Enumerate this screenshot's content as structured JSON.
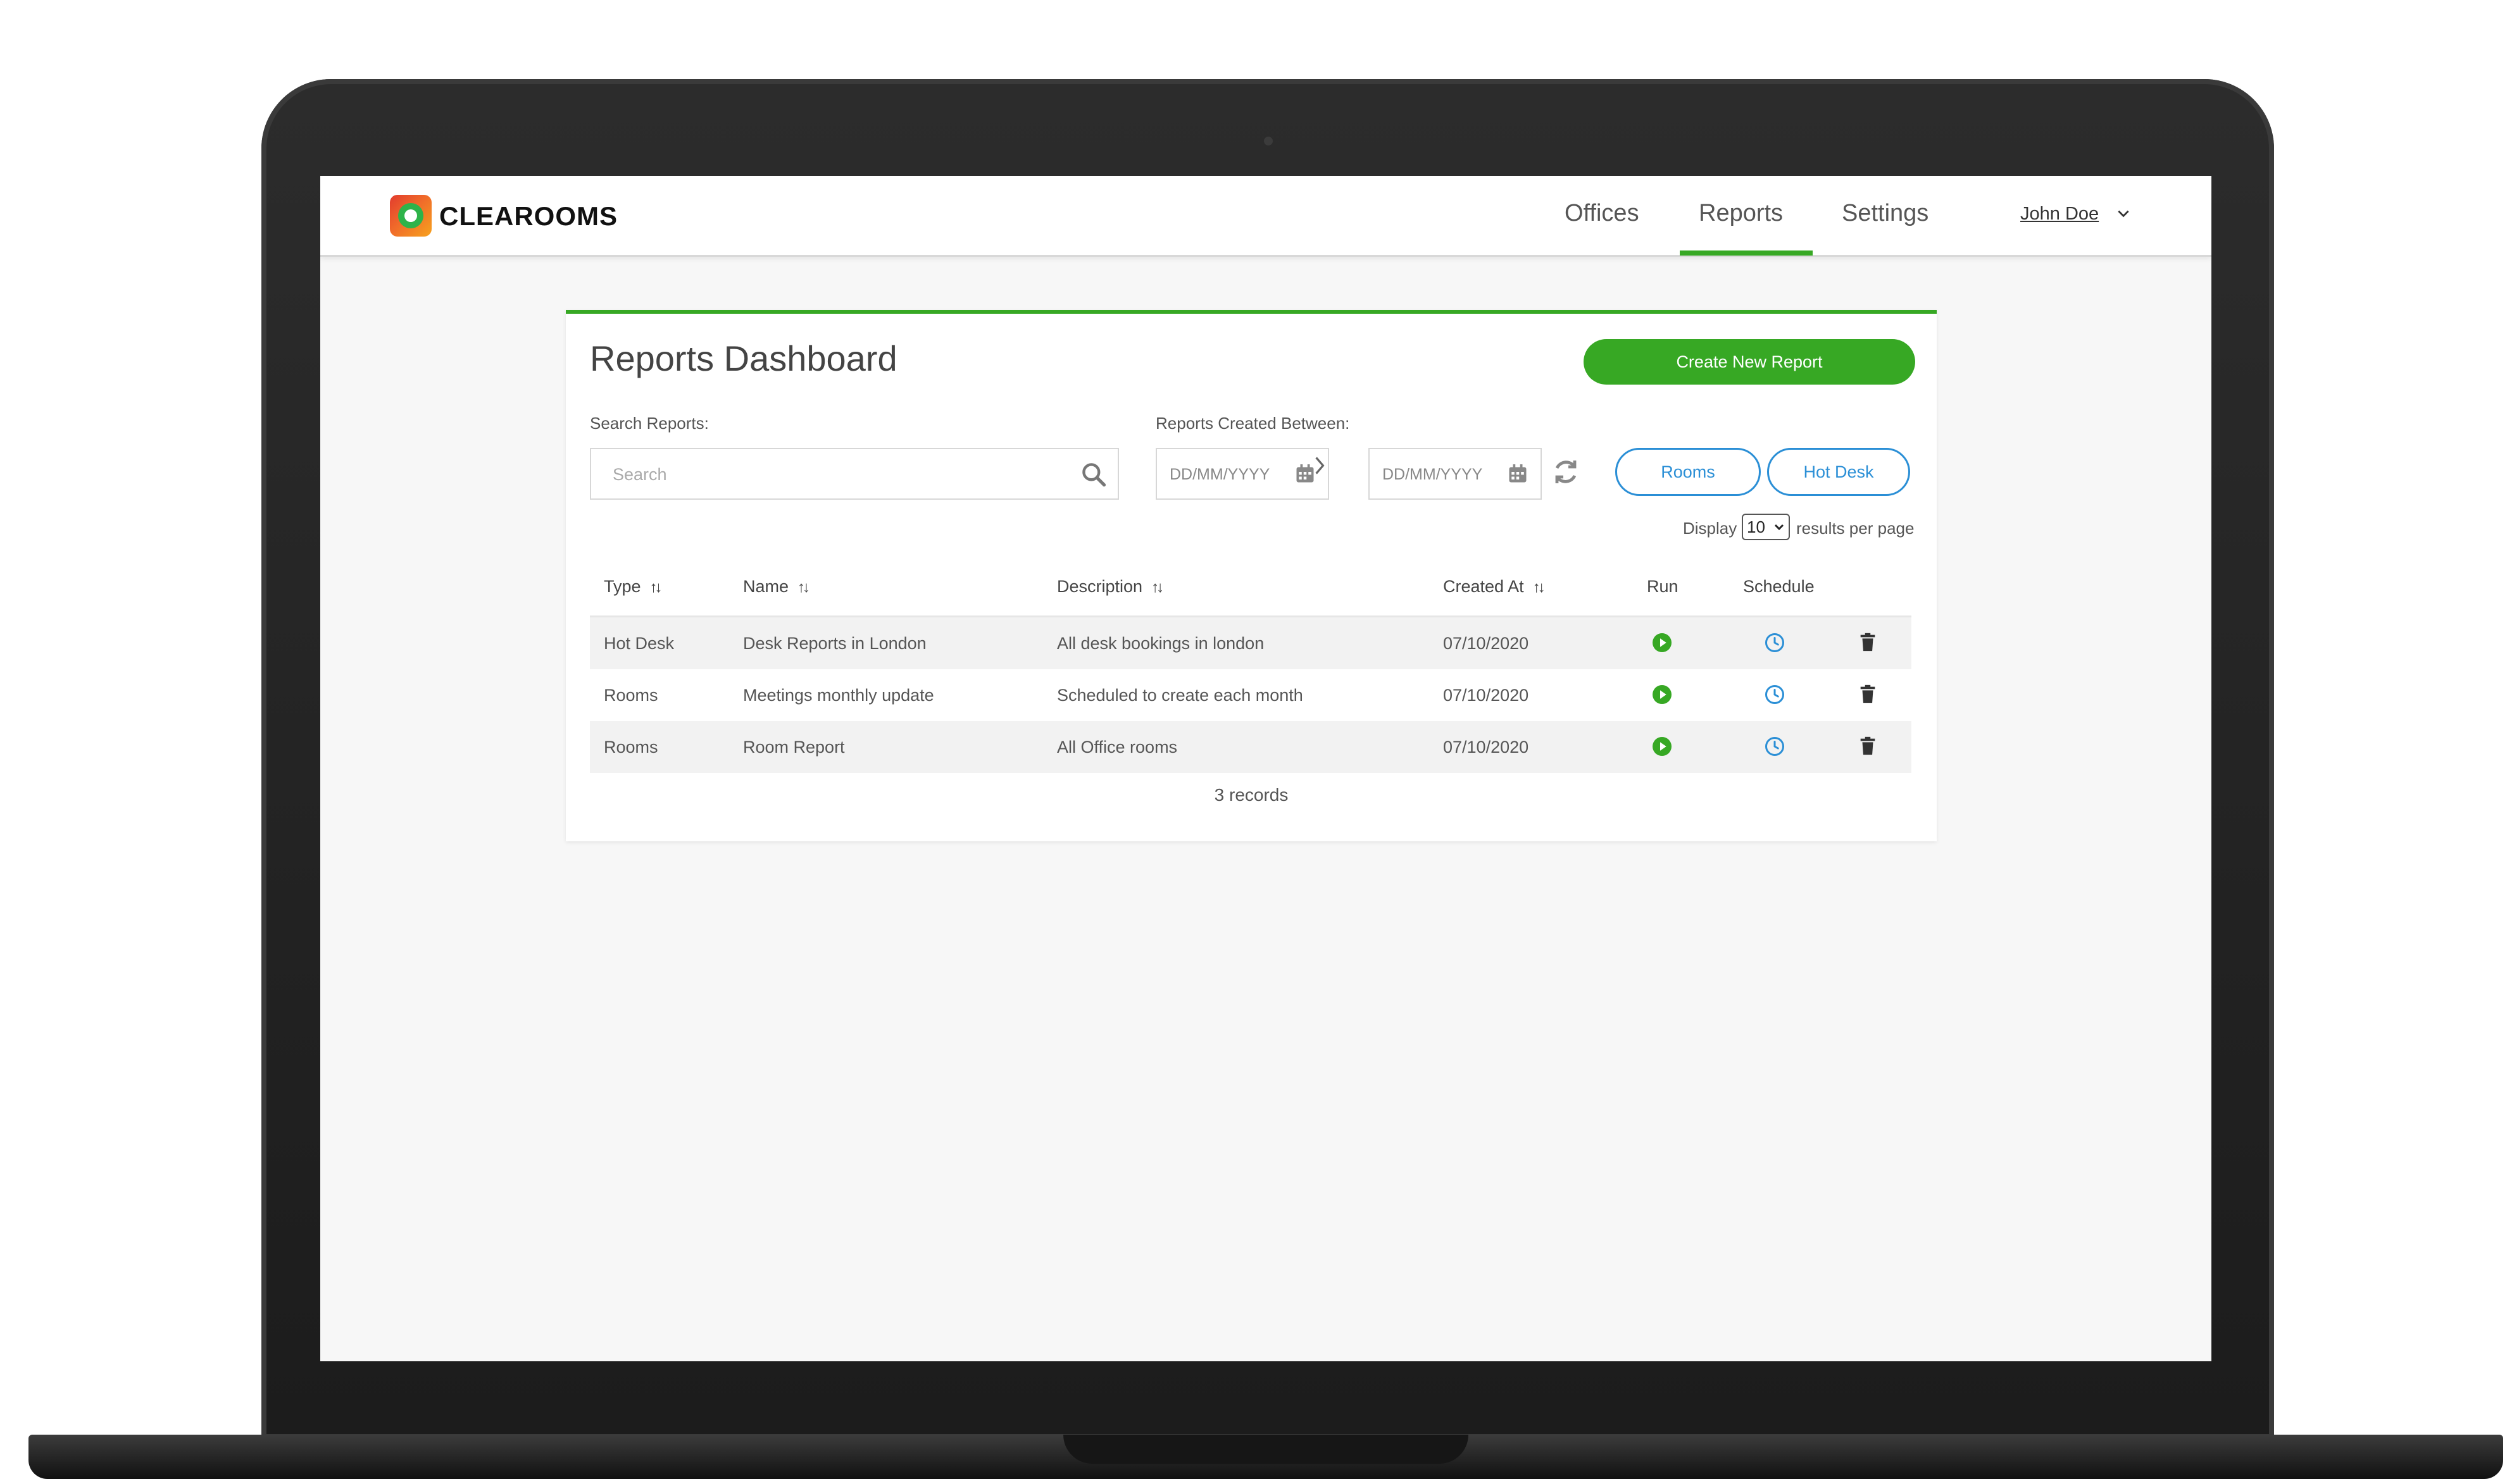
{
  "app": {
    "brand": "CLEAROOMS",
    "colors": {
      "accent": "#37a824",
      "link_blue": "#2b8fd6",
      "text": "#555555"
    }
  },
  "nav": {
    "tabs": [
      {
        "label": "Offices",
        "active": false
      },
      {
        "label": "Reports",
        "active": true
      },
      {
        "label": "Settings",
        "active": false
      }
    ],
    "user": "John Doe"
  },
  "dashboard": {
    "title": "Reports Dashboard",
    "create_button": "Create New Report",
    "search_label": "Search Reports:",
    "search_placeholder": "Search",
    "date_label": "Reports Created Between:",
    "date_from_placeholder": "DD/MM/YYYY",
    "date_to_placeholder": "DD/MM/YYYY",
    "filters": [
      "Rooms",
      "Hot Desk"
    ],
    "display_label": "Display",
    "per_page_value": "10",
    "per_page_suffix": "results per page"
  },
  "table": {
    "headers": [
      "Type",
      "Name",
      "Description",
      "Created At",
      "Run",
      "Schedule"
    ],
    "rows": [
      {
        "type": "Hot Desk",
        "name": "Desk Reports in London",
        "description": "All desk bookings in london",
        "created_at": "07/10/2020"
      },
      {
        "type": "Rooms",
        "name": "Meetings monthly update",
        "description": "Scheduled to create each month",
        "created_at": "07/10/2020"
      },
      {
        "type": "Rooms",
        "name": "Room Report",
        "description": "All Office rooms",
        "created_at": "07/10/2020"
      }
    ],
    "records_text": "3 records",
    "icons": {
      "run": "play-circle-icon",
      "schedule": "clock-icon",
      "delete": "trash-icon"
    }
  }
}
